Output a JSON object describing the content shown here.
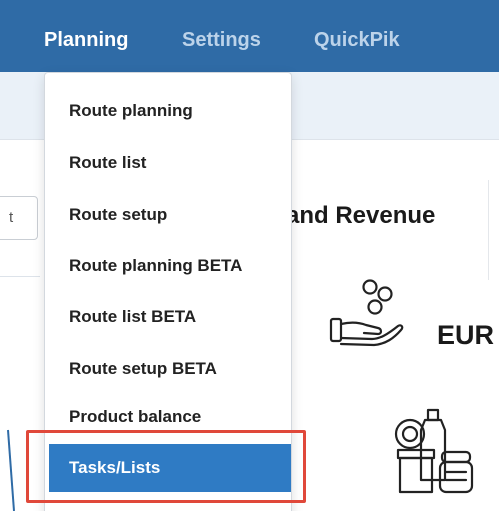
{
  "navbar": {
    "items": [
      {
        "label": "Planning",
        "active": true
      },
      {
        "label": "Settings",
        "active": false
      },
      {
        "label": "QuickPik",
        "active": false
      }
    ]
  },
  "filter_button_text": "t",
  "section_title": "s and Revenue",
  "currency_label": "EUR",
  "dropdown": {
    "items": [
      {
        "label": "Route planning"
      },
      {
        "label": "Route list"
      },
      {
        "label": "Route setup"
      },
      {
        "label": "Route planning BETA"
      },
      {
        "label": "Route list BETA"
      },
      {
        "label": "Route setup BETA"
      },
      {
        "label": "Product balance"
      },
      {
        "label": "Tasks/Lists",
        "active": true
      }
    ]
  },
  "colors": {
    "navbar": "#2f6ba6",
    "active_menu": "#2f7bc4",
    "highlight": "#e0483a"
  }
}
